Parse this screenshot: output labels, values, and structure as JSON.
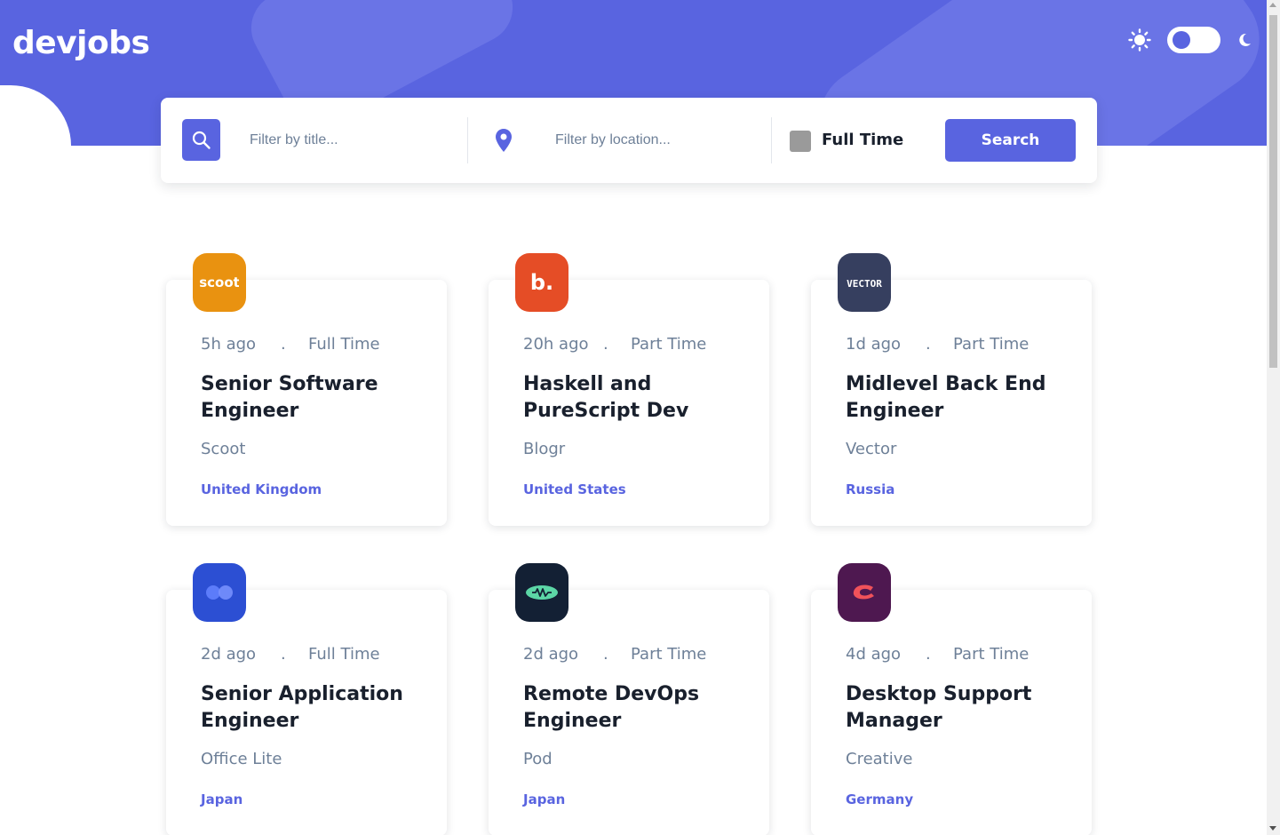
{
  "header": {
    "logo": "devjobs"
  },
  "theme": {
    "sun_icon": "sun-icon",
    "moon_icon": "moon-icon",
    "mode": "light"
  },
  "search": {
    "title_placeholder": "Filter by title...",
    "title_value": "",
    "location_placeholder": "Filter by location...",
    "location_value": "",
    "fulltime_label": "Full Time",
    "fulltime_checked": false,
    "button_label": "Search"
  },
  "colors": {
    "accent": "#5964e0",
    "text_dark": "#19202d",
    "text_gray": "#6e8098"
  },
  "jobs": [
    {
      "posted": "5h ago",
      "separator": ".",
      "contract": "Full Time",
      "title": "Senior Software Engineer",
      "company": "Scoot",
      "location": "United Kingdom",
      "logo_color": "#e99210",
      "logo_text": "scoot"
    },
    {
      "posted": "20h ago",
      "separator": ".",
      "contract": "Part Time",
      "title": "Haskell and PureScript Dev",
      "company": "Blogr",
      "location": "United States",
      "logo_color": "#e54d26",
      "logo_text": "b."
    },
    {
      "posted": "1d ago",
      "separator": ".",
      "contract": "Part Time",
      "title": "Midlevel Back End Engineer",
      "company": "Vector",
      "location": "Russia",
      "logo_color": "#363f5f",
      "logo_text": "VECTOR"
    },
    {
      "posted": "2d ago",
      "separator": ".",
      "contract": "Full Time",
      "title": "Senior Application Engineer",
      "company": "Office Lite",
      "location": "Japan",
      "logo_color": "#2c4fd3",
      "logo_text": ""
    },
    {
      "posted": "2d ago",
      "separator": ".",
      "contract": "Part Time",
      "title": "Remote DevOps Engineer",
      "company": "Pod",
      "location": "Japan",
      "logo_color": "#132034",
      "logo_text": ""
    },
    {
      "posted": "4d ago",
      "separator": ".",
      "contract": "Part Time",
      "title": "Desktop Support Manager",
      "company": "Creative",
      "location": "Germany",
      "logo_color": "#4e1850",
      "logo_text": ""
    }
  ]
}
